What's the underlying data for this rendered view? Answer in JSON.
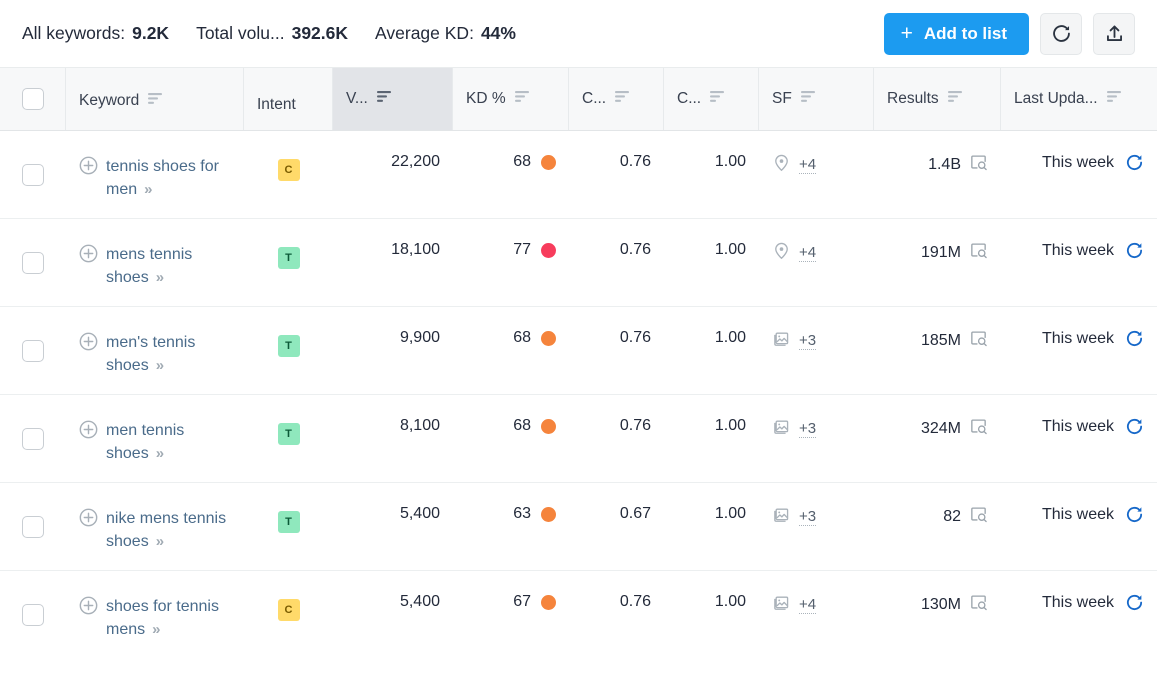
{
  "topbar": {
    "summary": [
      {
        "label": "All keywords:",
        "value": "9.2K"
      },
      {
        "label": "Total volu...",
        "value": "392.6K"
      },
      {
        "label": "Average KD:",
        "value": "44%"
      }
    ],
    "add_to_list_label": "Add to list",
    "add_to_list_plus": "+",
    "refresh_icon": "refresh-icon",
    "export_icon": "export-icon",
    "accent_color": "#1c9bf0"
  },
  "table": {
    "columns": [
      {
        "key": "check",
        "label": "",
        "sortable": false,
        "active": false
      },
      {
        "key": "keyword",
        "label": "Keyword",
        "sortable": true,
        "active": false
      },
      {
        "key": "intent",
        "label": "Intent",
        "sortable": false,
        "active": false
      },
      {
        "key": "volume",
        "label": "V...",
        "sortable": true,
        "active": true
      },
      {
        "key": "kd",
        "label": "KD %",
        "sortable": true,
        "active": false
      },
      {
        "key": "cpc",
        "label": "C...",
        "sortable": true,
        "active": false
      },
      {
        "key": "com",
        "label": "C...",
        "sortable": true,
        "active": false
      },
      {
        "key": "sf",
        "label": "SF",
        "sortable": true,
        "active": false
      },
      {
        "key": "results",
        "label": "Results",
        "sortable": true,
        "active": false
      },
      {
        "key": "updated",
        "label": "Last Upda...",
        "sortable": true,
        "active": false
      }
    ],
    "rows": [
      {
        "keyword": "tennis shoes for men",
        "chevron": "»",
        "intent": "C",
        "volume": "22,200",
        "kd": "68",
        "kd_color": "#f5843c",
        "cpc": "0.76",
        "com": "1.00",
        "sf_icon": "map-pin-icon",
        "sf_more": "+4",
        "results": "1.4B",
        "updated": "This week"
      },
      {
        "keyword": "mens tennis shoes",
        "chevron": "»",
        "intent": "T",
        "volume": "18,100",
        "kd": "77",
        "kd_color": "#f73c5c",
        "cpc": "0.76",
        "com": "1.00",
        "sf_icon": "map-pin-icon",
        "sf_more": "+4",
        "results": "191M",
        "updated": "This week"
      },
      {
        "keyword": "men's tennis shoes",
        "chevron": "»",
        "intent": "T",
        "volume": "9,900",
        "kd": "68",
        "kd_color": "#f5843c",
        "cpc": "0.76",
        "com": "1.00",
        "sf_icon": "images-icon",
        "sf_more": "+3",
        "results": "185M",
        "updated": "This week"
      },
      {
        "keyword": "men tennis shoes",
        "chevron": "»",
        "intent": "T",
        "volume": "8,100",
        "kd": "68",
        "kd_color": "#f5843c",
        "cpc": "0.76",
        "com": "1.00",
        "sf_icon": "images-icon",
        "sf_more": "+3",
        "results": "324M",
        "updated": "This week"
      },
      {
        "keyword": "nike mens tennis shoes",
        "chevron": "»",
        "intent": "T",
        "volume": "5,400",
        "kd": "63",
        "kd_color": "#f5843c",
        "cpc": "0.67",
        "com": "1.00",
        "sf_icon": "images-icon",
        "sf_more": "+3",
        "results": "82",
        "updated": "This week"
      },
      {
        "keyword": "shoes for tennis mens",
        "chevron": "»",
        "intent": "C",
        "volume": "5,400",
        "kd": "67",
        "kd_color": "#f5843c",
        "cpc": "0.76",
        "com": "1.00",
        "sf_icon": "images-icon",
        "sf_more": "+4",
        "results": "130M",
        "updated": "This week"
      }
    ]
  }
}
